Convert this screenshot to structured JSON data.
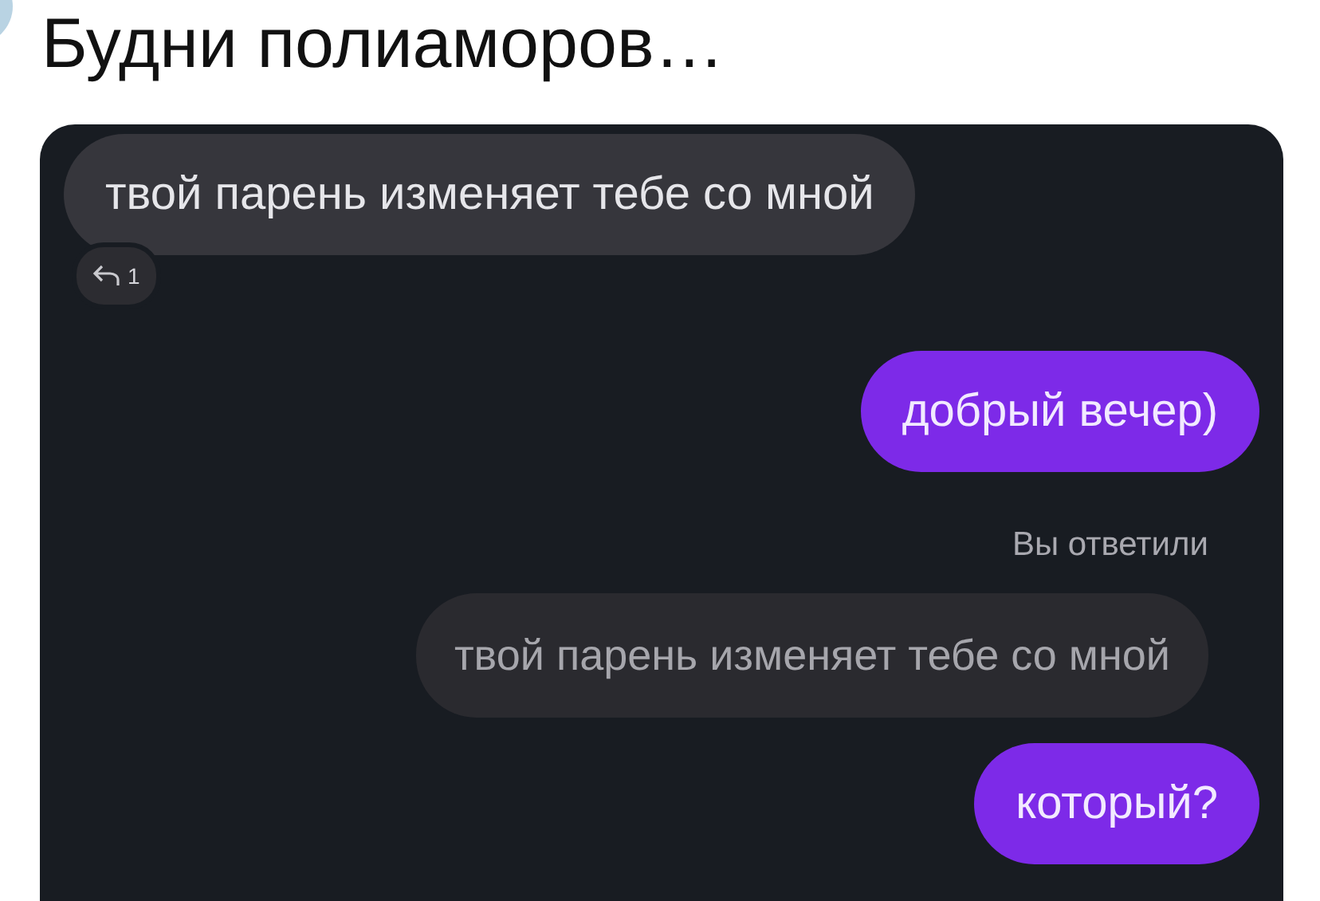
{
  "post": {
    "text": "Будни полиаморов…"
  },
  "chat": {
    "messages": [
      {
        "kind": "incoming",
        "text": "твой парень изменяет тебе со мной",
        "reply_count": "1"
      },
      {
        "kind": "outgoing",
        "text": "добрый вечер)"
      },
      {
        "kind": "reply_label",
        "text": "Вы ответили"
      },
      {
        "kind": "quoted",
        "text": "твой парень изменяет тебе со мной"
      },
      {
        "kind": "outgoing",
        "text": "который?"
      }
    ]
  }
}
